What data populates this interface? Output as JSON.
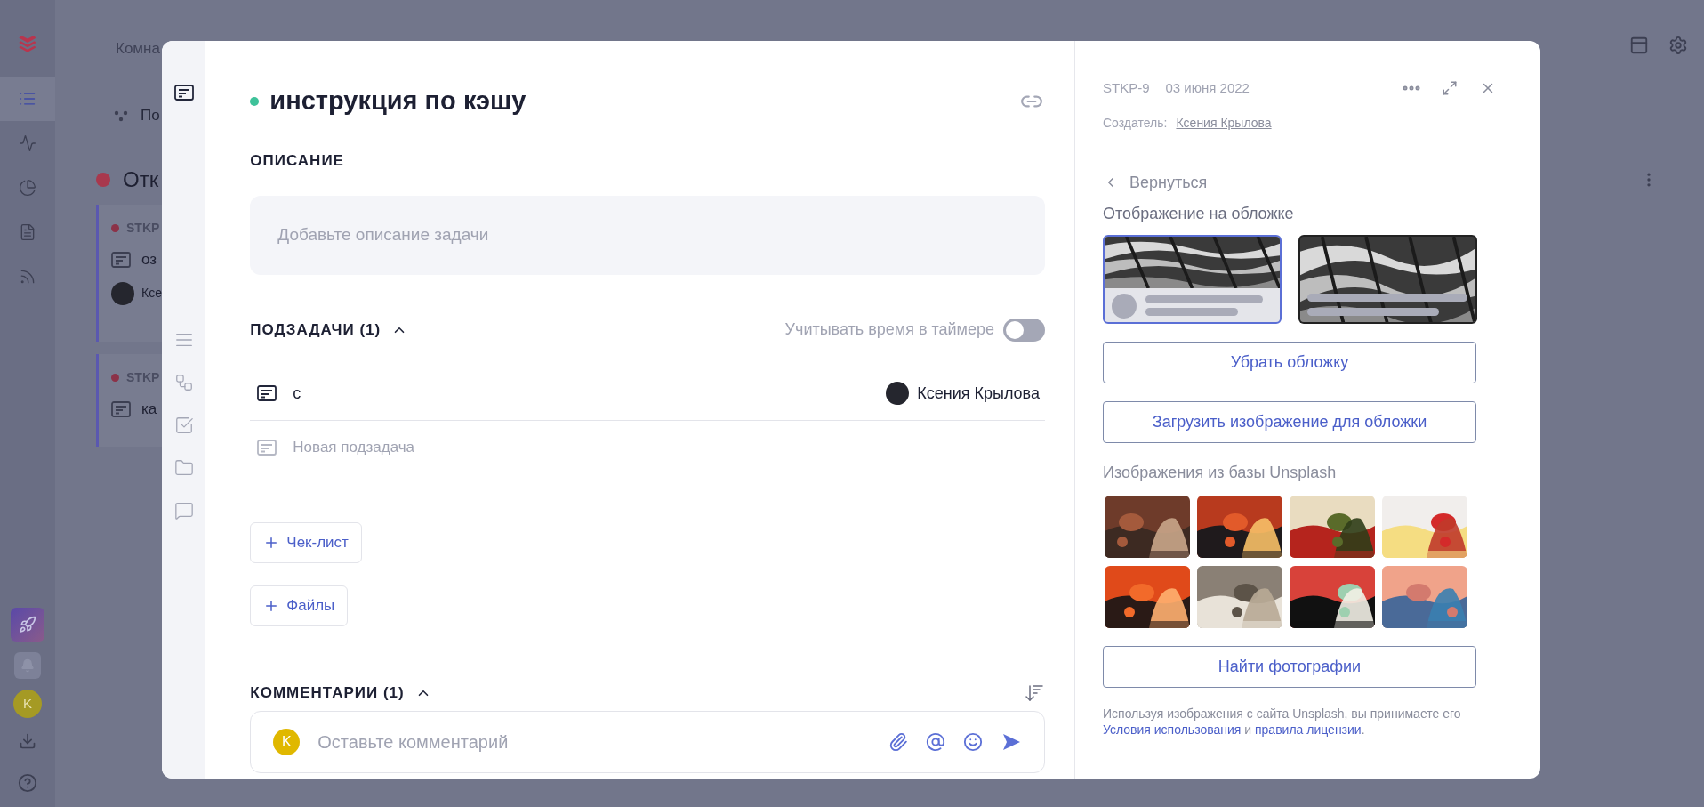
{
  "app_sidebar": {
    "nav": [
      {
        "selected": true
      },
      {
        "selected": false
      },
      {
        "selected": false
      },
      {
        "selected": false
      },
      {
        "selected": false
      }
    ],
    "user_avatar": "K"
  },
  "background": {
    "breadcrumb": "Комна",
    "view_label": "По",
    "group_title": "Отк",
    "cards": [
      {
        "key": "STKP",
        "title": "оз",
        "assignee": "Ксе"
      },
      {
        "key": "STKP",
        "title": "ка"
      }
    ]
  },
  "task": {
    "title": "инструкция по кэшу",
    "description_label": "ОПИСАНИЕ",
    "description_placeholder": "Добавьте описание задачи",
    "subtasks": {
      "title": "ПОДЗАДАЧИ (1)",
      "expanded": true,
      "timer_label": "Учитывать время в таймере",
      "timer_on": false,
      "items": [
        {
          "title": "с",
          "assignee": "Ксения Крылова"
        }
      ],
      "new_placeholder": "Новая подзадача"
    },
    "buttons": [
      "Чек-лист",
      "Файлы"
    ],
    "comments": {
      "title": "КОММЕНТАРИИ (1)",
      "expanded": true,
      "avatar": "K",
      "placeholder": "Оставьте комментарий"
    }
  },
  "details": {
    "key": "STKP-9",
    "date": "03 июня 2022",
    "creator_label": "Создатель:",
    "creator": "Ксения Крылова",
    "back": "Вернуться",
    "cover_label": "Отображение на обложке",
    "cover_options": [
      {
        "kind": "below",
        "selected": true
      },
      {
        "kind": "overlay",
        "selected": false
      }
    ],
    "remove_cover": "Убрать обложку",
    "upload_cover": "Загрузить изображение для обложки",
    "unsplash_label": "Изображения из базы Unsplash",
    "find_photos": "Найти фотографии",
    "notice": {
      "text": "Используя изображения с сайта Unsplash, вы принимаете его",
      "link1": "Условия использования",
      "joiner": "и",
      "link2": "правила лицензии",
      "end": "."
    }
  }
}
